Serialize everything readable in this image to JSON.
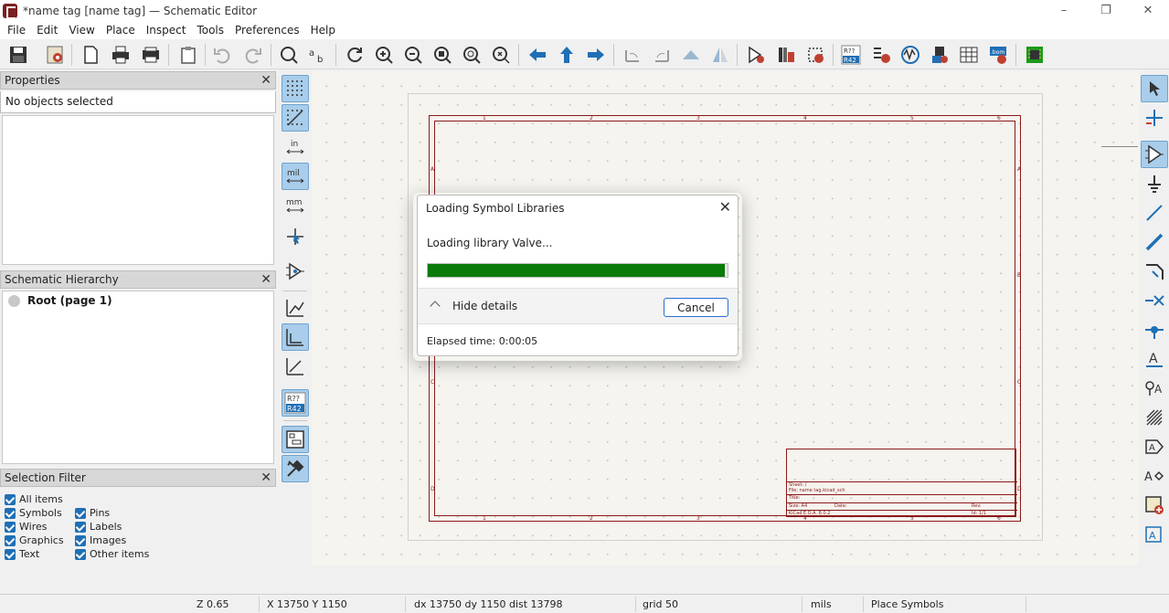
{
  "window": {
    "title": "*name tag [name tag] — Schematic Editor",
    "minimize": "–",
    "maximize": "❐",
    "close": "✕"
  },
  "menu": [
    "File",
    "Edit",
    "View",
    "Place",
    "Inspect",
    "Tools",
    "Preferences",
    "Help"
  ],
  "toolbar_icons": [
    "save-icon",
    "schematic-setup-icon",
    "page-settings-icon",
    "print-icon",
    "plot-icon",
    "paste-icon",
    "undo-icon",
    "redo-icon",
    "find-icon",
    "find-replace-icon",
    "refresh-icon",
    "zoom-in-icon",
    "zoom-out-icon",
    "zoom-fit-icon",
    "zoom-objects-icon",
    "zoom-selection-icon",
    "navigate-back-icon",
    "navigate-up-icon",
    "navigate-forward-icon",
    "rotate-ccw-icon",
    "rotate-cw-icon",
    "mirror-vertical-icon",
    "mirror-horizontal-icon",
    "symbol-editor-icon",
    "symbol-library-browser-icon",
    "footprint-editor-icon",
    "annotate-icon",
    "erc-icon",
    "simulator-icon",
    "assign-footprints-icon",
    "symbol-fields-table-icon",
    "bom-icon",
    "open-pcb-icon"
  ],
  "annotate_icon_text": {
    "top": "R??",
    "bottom": "R42"
  },
  "bom_icon_text": ".bom",
  "panels": {
    "properties": {
      "title": "Properties",
      "selection": "No objects selected"
    },
    "hierarchy": {
      "title": "Schematic Hierarchy",
      "root": "Root (page 1)"
    },
    "filter": {
      "title": "Selection Filter",
      "all_items": "All items",
      "items": [
        "Symbols",
        "Pins",
        "Wires",
        "Labels",
        "Graphics",
        "Images",
        "Text",
        "Other items"
      ]
    },
    "close_glyph": "✕"
  },
  "left_tools": {
    "units_in": "in",
    "units_mil": "mil",
    "units_mm": "mm",
    "annotate_top": "R??",
    "annotate_bottom": "R42"
  },
  "sheet": {
    "columns": [
      "1",
      "2",
      "3",
      "4",
      "5",
      "6"
    ],
    "rows": [
      "A",
      "B",
      "C",
      "D"
    ],
    "title_block": {
      "sheet": "Sheet: /",
      "file": "File: name tag.kicad_sch",
      "title": "Title:",
      "size": "Size: A4",
      "date": "Date:",
      "rev": "Rev:",
      "kicad": "KiCad E.D.A. 8.0.2",
      "id": "Id: 1/1"
    }
  },
  "dialog": {
    "title": "Loading Symbol Libraries",
    "message": "Loading library Valve...",
    "progress": 0.99,
    "hide_details": "Hide details",
    "cancel": "Cancel",
    "elapsed": "Elapsed time: 0:00:05",
    "close_glyph": "✕",
    "progress_color": "#0a7a0a"
  },
  "status": {
    "zoom": "Z 0.65",
    "position": "X 13750  Y 1150",
    "delta": "dx 13750  dy 1150  dist 13798",
    "grid": "grid 50",
    "units": "mils",
    "mode": "Place Symbols"
  },
  "colors": {
    "accent_blue": "#1f6fb5",
    "active_tool": "#a9cdea",
    "sheet_border": "#8b1a1a",
    "canvas": "#f5f4ef"
  }
}
